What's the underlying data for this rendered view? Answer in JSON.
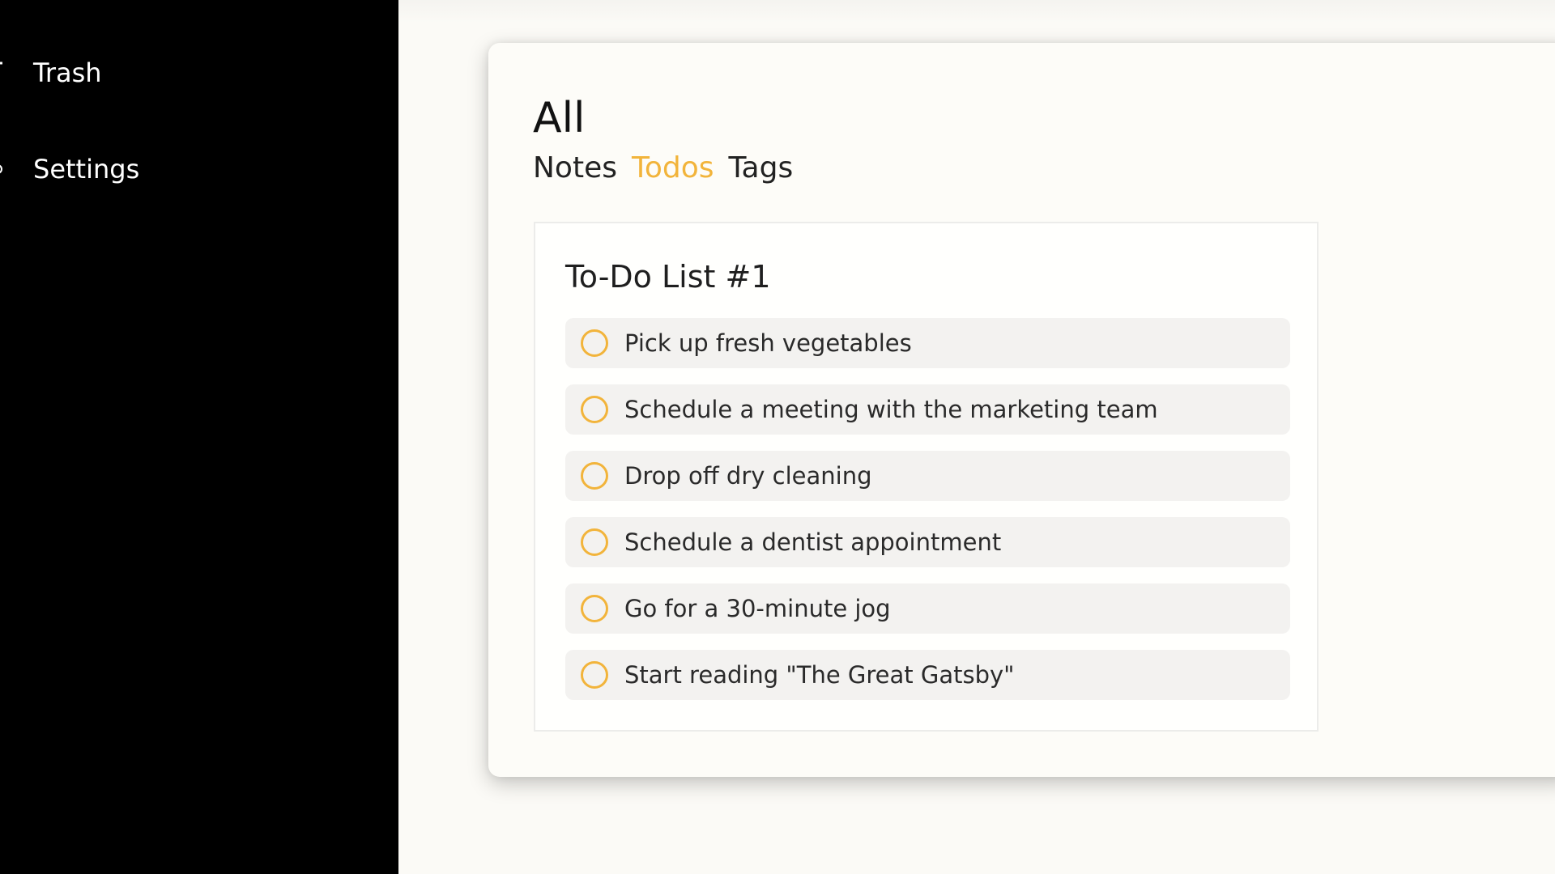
{
  "sidebar": {
    "items": [
      {
        "label": "Trash",
        "icon": "trash-icon"
      },
      {
        "label": "Settings",
        "icon": "settings-icon"
      }
    ],
    "background": "#000000",
    "text_color": "#ffffff"
  },
  "main": {
    "title": "All",
    "tabs": [
      {
        "label": "Notes",
        "active": false
      },
      {
        "label": "Todos",
        "active": true
      },
      {
        "label": "Tags",
        "active": false
      }
    ],
    "accent_color": "#f2b43b"
  },
  "todo_list": {
    "title": "To-Do List #1",
    "items": [
      {
        "text": "Pick up fresh vegetables",
        "checked": false
      },
      {
        "text": "Schedule a meeting with the marketing team",
        "checked": false
      },
      {
        "text": "Drop off dry cleaning",
        "checked": false
      },
      {
        "text": "Schedule a dentist appointment",
        "checked": false
      },
      {
        "text": "Go for a 30-minute jog",
        "checked": false
      },
      {
        "text": "Start reading \"The Great Gatsby\"",
        "checked": false
      }
    ]
  }
}
